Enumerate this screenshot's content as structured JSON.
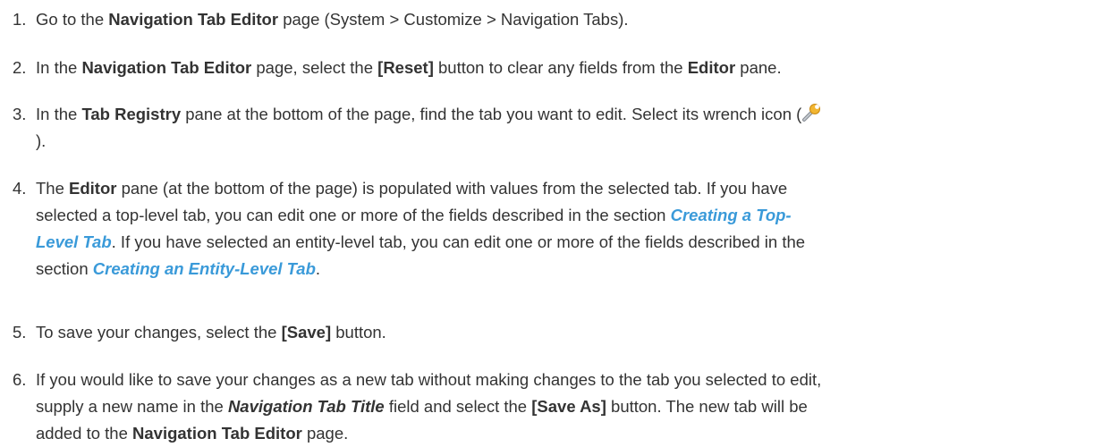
{
  "steps": [
    {
      "num": "1.",
      "t1": "Go to the ",
      "b1": "Navigation Tab Editor",
      "t2": " page (System > Customize > Navigation Tabs)."
    },
    {
      "num": "2.",
      "t1": "In the ",
      "b1": "Navigation Tab Editor",
      "t2": " page, select the ",
      "b2": "[Reset]",
      "t3": " button to clear any fields from the ",
      "b3": "Editor",
      "t4": " pane."
    },
    {
      "num": "3.",
      "t1": "In the ",
      "b1": "Tab Registry",
      "t2": " pane at the bottom of the page, find the tab you want to edit. Select its wrench icon (",
      "icon": "wrench-icon",
      "t3": ")."
    },
    {
      "num": "4.",
      "t1": "The ",
      "b1": "Editor",
      "t2": " pane (at the bottom of the page) is populated with values from the selected tab. If you have",
      "t3": "selected a top-level tab, you can edit one or more of the fields described in the section ",
      "link1a": "Creating a Top-",
      "link1b": "Level Tab",
      "t4": ". If you have selected an entity-level tab, you can edit one or more of the fields described in the",
      "t5": "section ",
      "link2": "Creating an Entity-Level Tab",
      "t6": "."
    },
    {
      "num": "5.",
      "t1": "To save your changes, select the ",
      "b1": "[Save]",
      "t2": " button."
    },
    {
      "num": "6.",
      "t1": "If you would like to save your changes as a new tab without making changes to the tab you selected to edit,",
      "t2": "supply a new name in the ",
      "bi1": "Navigation Tab Title",
      "t3": " field and select the ",
      "b1": "[Save As]",
      "t4": " button. The new tab will be",
      "t5": "added to the ",
      "b2": "Navigation Tab Editor",
      "t6": " page."
    }
  ]
}
